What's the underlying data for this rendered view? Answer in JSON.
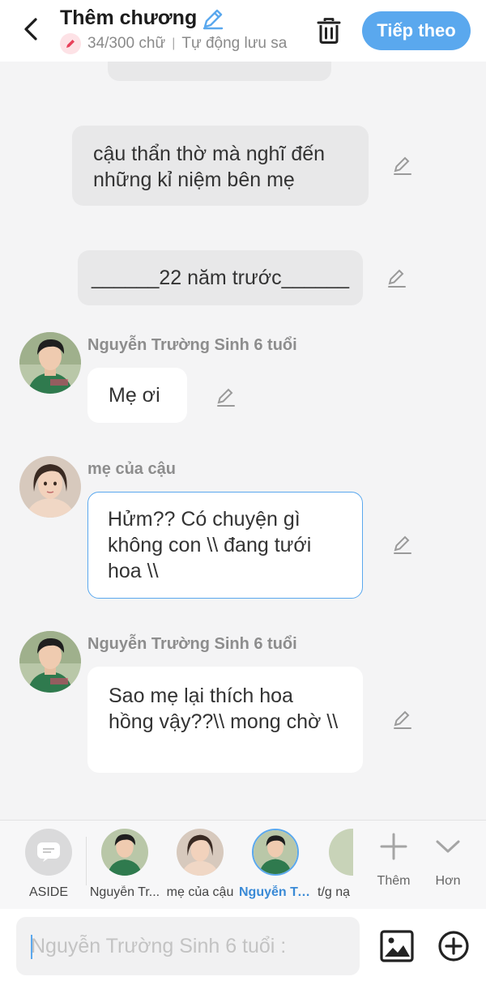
{
  "header": {
    "title": "Thêm chương",
    "subtitle_count": "34/300 chữ",
    "subtitle_sep": "|",
    "subtitle_status": "Tự động lưu sa",
    "next_label": "Tiếp theo"
  },
  "messages": [
    {
      "type": "narration",
      "text": "cậu thẩn thờ mà nghĩ đến những kỉ niệm bên mẹ"
    },
    {
      "type": "narration",
      "text": "______22 năm trước______"
    },
    {
      "type": "dialogue",
      "speaker": "Nguyễn Trường Sinh 6 tuổi",
      "text": "Mẹ ơi"
    },
    {
      "type": "dialogue",
      "speaker": "mẹ của cậu",
      "text": "Hửm?? Có chuyện gì không con \\\\ đang tưới hoa \\\\"
    },
    {
      "type": "dialogue",
      "speaker": "Nguyễn Trường Sinh 6 tuổi",
      "text": "Sao mẹ lại thích hoa hồng vậy??\\\\ mong chờ \\\\"
    }
  ],
  "character_bar": {
    "items": [
      {
        "label": "ASIDE"
      },
      {
        "label": "Nguyễn Tr..."
      },
      {
        "label": "mẹ của cậu"
      },
      {
        "label": "Nguyễn Tr...",
        "selected": true
      },
      {
        "label": "t/g nạ"
      }
    ],
    "add_label": "Thêm",
    "more_label": "Hơn"
  },
  "input": {
    "placeholder": "Nguyễn Trường Sinh 6 tuổi :"
  },
  "colors": {
    "accent": "#5aa8ee",
    "narration_bg": "#e8e8e9",
    "bubble_bg": "#ffffff",
    "page_bg": "#f4f4f5"
  }
}
